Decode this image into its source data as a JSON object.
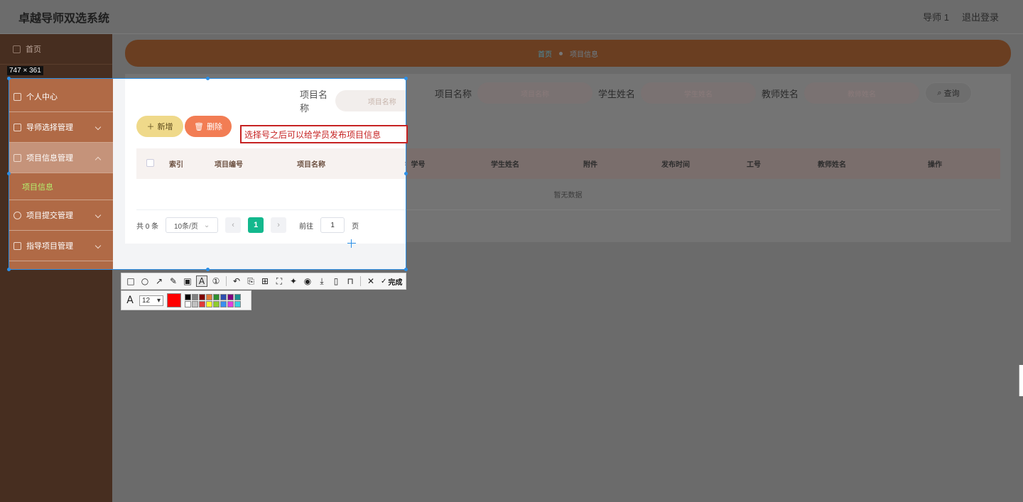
{
  "app": {
    "title": "卓越导师双选系统",
    "user": "导师 1",
    "logout": "退出登录"
  },
  "sidebar": {
    "items": [
      {
        "label": "首页"
      },
      {
        "label": "个人中心"
      },
      {
        "label": "导师选择管理"
      },
      {
        "label": "项目信息管理"
      },
      {
        "label": "项目信息"
      },
      {
        "label": "项目提交管理"
      },
      {
        "label": "指导项目管理"
      }
    ]
  },
  "breadcrumb": {
    "home": "首页",
    "current": "项目信息"
  },
  "search": {
    "project_label": "项目名称",
    "project_placeholder": "项目名称",
    "student_label": "学生姓名",
    "student_placeholder": "学生姓名",
    "teacher_label": "教师姓名",
    "teacher_placeholder": "教师姓名",
    "button": "查询"
  },
  "actions": {
    "add": "新增",
    "delete": "删除"
  },
  "annotation": "选择号之后可以给学员发布项目信息",
  "table": {
    "columns": [
      "索引",
      "项目编号",
      "项目名称",
      "学号",
      "学生姓名",
      "附件",
      "发布时间",
      "工号",
      "教师姓名",
      "操作"
    ],
    "empty": "暂无数据"
  },
  "pagination": {
    "total": "共 0 条",
    "page_size": "10条/页",
    "current": "1",
    "goto": "前往",
    "goto_value": "1",
    "page_unit": "页"
  },
  "capture": {
    "size_label": "747 × 361",
    "done": "完成",
    "font_size": "12",
    "current_color": "#ff0000",
    "palette": [
      "#000000",
      "#808080",
      "#800000",
      "#e07b39",
      "#2f8f2f",
      "#2c4fb0",
      "#800080",
      "#1a8f8f",
      "#ffffff",
      "#c0c0c0",
      "#e03a3a",
      "#f5f532",
      "#8fcc2f",
      "#3a8ff0",
      "#e040e0",
      "#3ad0e0"
    ]
  }
}
